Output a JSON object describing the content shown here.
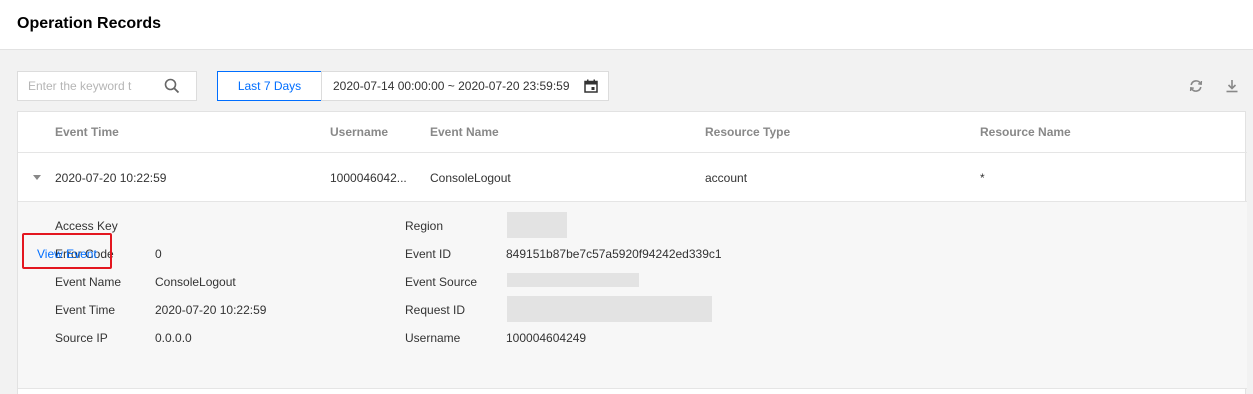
{
  "page": {
    "title": "Operation Records"
  },
  "toolbar": {
    "search_placeholder": "Enter the keyword t",
    "quick_range_label": "Last 7 Days",
    "date_range": "2020-07-14 00:00:00 ~ 2020-07-20 23:59:59",
    "icons": [
      "search-icon",
      "calendar-icon",
      "refresh-icon",
      "download-icon"
    ]
  },
  "table": {
    "columns": [
      "Event Time",
      "Username",
      "Event Name",
      "Resource Type",
      "Resource Name"
    ],
    "rows": [
      {
        "event_time": "2020-07-20 10:22:59",
        "username": "1000046042...",
        "event_name": "ConsoleLogout",
        "resource_type": "account",
        "resource_name": "*"
      }
    ]
  },
  "detail": {
    "left": [
      {
        "label": "Access Key",
        "value": ""
      },
      {
        "label": "Error Code",
        "value": "0"
      },
      {
        "label": "Event Name",
        "value": "ConsoleLogout"
      },
      {
        "label": "Event Time",
        "value": "2020-07-20 10:22:59"
      },
      {
        "label": "Source IP",
        "value": "0.0.0.0"
      }
    ],
    "right": [
      {
        "label": "Region",
        "value": ""
      },
      {
        "label": "Event ID",
        "value": "849151b87be7c57a5920f94242ed339c1"
      },
      {
        "label": "Event Source",
        "value": ""
      },
      {
        "label": "Request ID",
        "value": ""
      },
      {
        "label": "Username",
        "value": "100004604249"
      }
    ],
    "link_label": "View Event"
  },
  "colors": {
    "accent": "#006eff",
    "highlight": "#e3161f"
  }
}
